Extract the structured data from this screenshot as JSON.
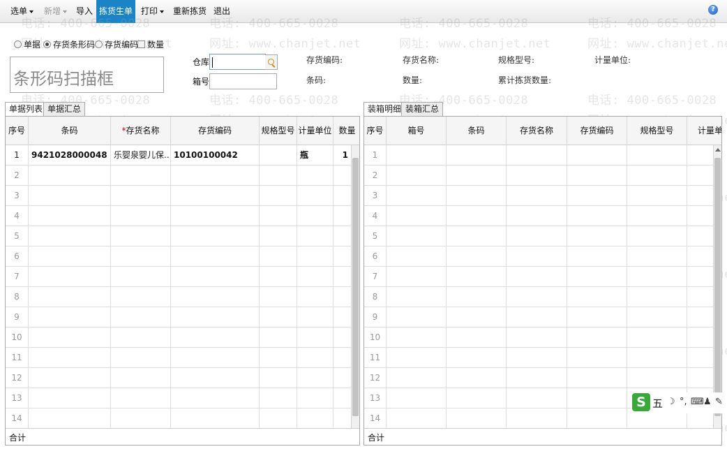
{
  "toolbar": {
    "items": [
      {
        "label": "选单",
        "dropdown": true
      },
      {
        "label": "新增",
        "dropdown": true,
        "disabled": true
      },
      {
        "label": "导入"
      },
      {
        "label": "拣货生单",
        "active": true
      },
      {
        "label": "打印",
        "dropdown": true
      },
      {
        "label": "重新拣货"
      },
      {
        "label": "退出"
      }
    ],
    "help": "?"
  },
  "scan_mode": {
    "options": [
      "单据",
      "存货条形码",
      "存货编码"
    ],
    "selected": "存货条形码",
    "quantity_label": "数量"
  },
  "scan_box": {
    "placeholder": "条形码扫描框"
  },
  "form": {
    "warehouse_label": "仓库",
    "box_label": "箱号"
  },
  "info": {
    "inventory_code": "存货编码:",
    "inventory_name": "存货名称:",
    "spec": "规格型号:",
    "unit": "计量单位:",
    "barcode": "条码:",
    "quantity": "数量:",
    "picked_quantity": "累计拣货数量:"
  },
  "left_tabs": [
    "单据列表",
    "单据汇总"
  ],
  "right_tabs": [
    "装箱明细",
    "装箱汇总"
  ],
  "left_grid": {
    "columns": [
      "序号",
      "条码",
      "存货名称",
      "存货编码",
      "规格型号",
      "计量单位",
      "数量"
    ],
    "rows": [
      {
        "no": "1",
        "barcode": "9421028000048",
        "name": "乐婴泉婴儿保...",
        "code": "10100100042",
        "spec": "",
        "unit": "瓶",
        "qty": "1"
      },
      {
        "no": "2"
      },
      {
        "no": "3"
      },
      {
        "no": "4"
      },
      {
        "no": "5"
      },
      {
        "no": "6"
      },
      {
        "no": "7"
      },
      {
        "no": "8"
      },
      {
        "no": "9"
      },
      {
        "no": "10"
      },
      {
        "no": "11"
      },
      {
        "no": "12"
      },
      {
        "no": "13"
      },
      {
        "no": "14"
      }
    ],
    "total_label": "合计"
  },
  "right_grid": {
    "columns": [
      "序号",
      "箱号",
      "条码",
      "存货名称",
      "存货编码",
      "规格型号",
      "计量单"
    ],
    "rows": [
      "1",
      "2",
      "3",
      "4",
      "5",
      "6",
      "7",
      "8",
      "9",
      "10",
      "11",
      "12",
      "13",
      "14"
    ],
    "total_label": "合计"
  },
  "watermark": {
    "phone": "电话: 400-665-0028",
    "site": "网址: www.chanjet.net"
  },
  "ime": {
    "logo": "S",
    "mode": "五"
  }
}
